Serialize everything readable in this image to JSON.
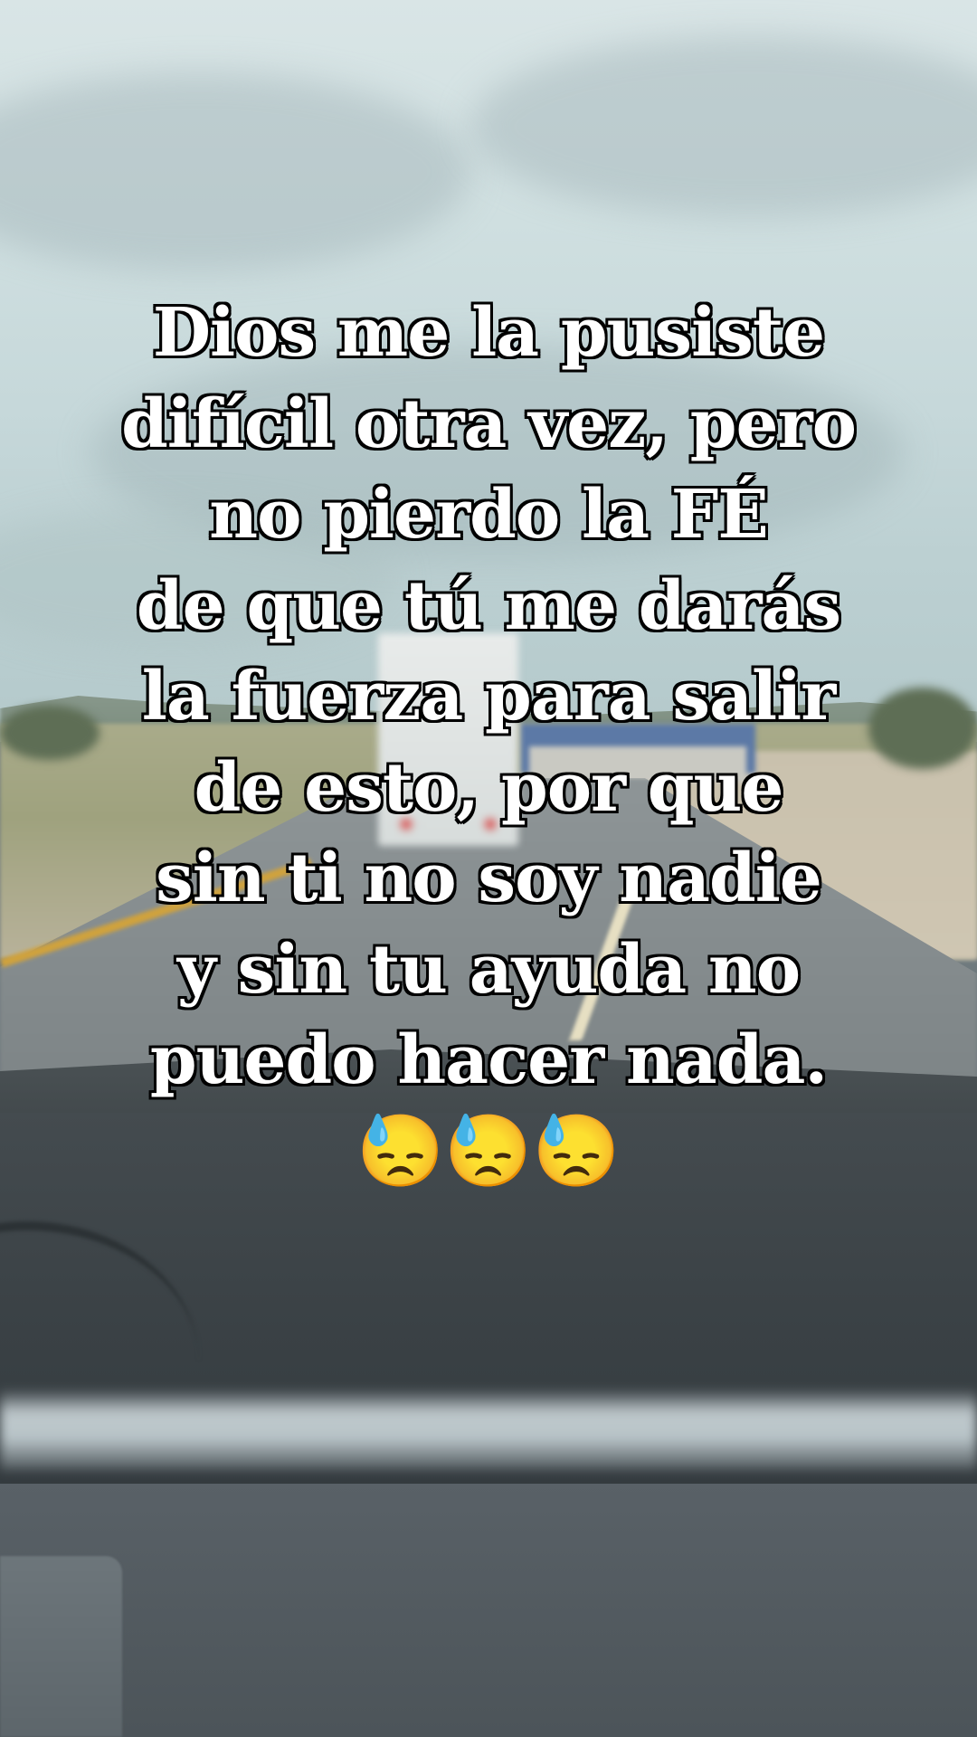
{
  "caption": {
    "lines": [
      "Dios me la pusiste",
      "difícil otra vez, pero",
      "no pierdo la FÉ",
      "de que tú me darás",
      "la fuerza para salir",
      "de esto, por que",
      "sin ti no soy nadie",
      "y sin tu ayuda no",
      "puedo hacer nada."
    ],
    "emoji": "😓😓😓"
  },
  "background": {
    "scene": "view through car windshield of a highway with a truck ahead and cloudy sky",
    "colors": {
      "sky": "#cfdfe0",
      "dashboard": "#3a4145",
      "caption_text": "#ffffff",
      "caption_outline": "#000000"
    }
  }
}
